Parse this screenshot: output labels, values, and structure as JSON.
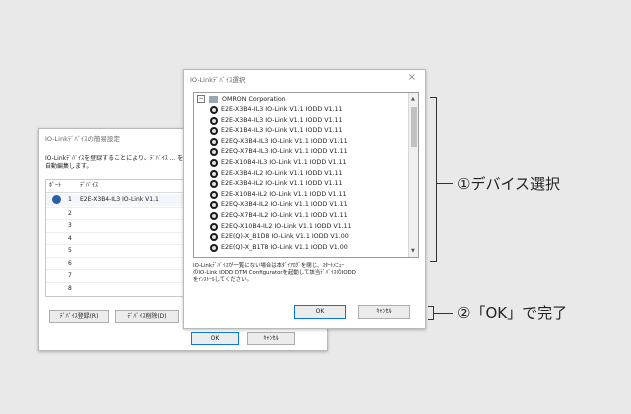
{
  "back_dialog": {
    "title": "IO-Linkﾃﾞﾊﾞｲｽの簡易設定",
    "description": "IO-Linkﾃﾞﾊﾞｲｽを登録することにより、ﾃﾞﾊﾞｲｽ ... を自動編集します。",
    "col_port": "ﾎﾟｰﾄ",
    "col_device": "ﾃﾞﾊﾞｲｽ",
    "ports": [
      "1",
      "2",
      "3",
      "4",
      "5",
      "6",
      "7",
      "8"
    ],
    "row1_device": "E2E-X3B4-IL3 IO-Link V1.1",
    "register_button": "ﾃﾞﾊﾞｲｽ登録(R)",
    "delete_button": "ﾃﾞﾊﾞｲｽ削除(D)",
    "ok_button": "OK",
    "cancel_button": "ｷｬﾝｾﾙ"
  },
  "front_dialog": {
    "title": "IO-Linkﾃﾞﾊﾞｲｽ選択",
    "close_glyph": "×",
    "root_node": "OMRON Corporation",
    "devices": [
      "E2E-X3B4-IL3 IO-Link V1.1 IODD V1.11",
      "E2E-X3B4-IL3 IO-Link V1.1 IODD V1.11",
      "E2E-X1B4-IL3 IO-Link V1.1 IODD V1.11",
      "E2EQ-X3B4-IL3 IO-Link V1.1 IODD V1.11",
      "E2EQ-X7B4-IL3 IO-Link V1.1 IODD V1.11",
      "E2E-X10B4-IL3 IO-Link V1.1 IODD V1.11",
      "E2E-X3B4-IL2 IO-Link V1.1 IODD V1.11",
      "E2E-X3B4-IL2 IO-Link V1.1 IODD V1.11",
      "E2E-X10B4-IL2 IO-Link V1.1 IODD V1.11",
      "E2EQ-X3B4-IL2 IO-Link V1.1 IODD V1.11",
      "E2EQ-X7B4-IL2 IO-Link V1.1 IODD V1.11",
      "E2EQ-X10B4-IL2 IO-Link V1.1 IODD V1.11",
      "E2E(Q)-X_B1D8 IO-Link V1.1 IODD V1.00",
      "E2E(Q)-X_B1T8 IO-Link V1.1 IODD V1.00"
    ],
    "note_line1": "IO-Linkﾃﾞﾊﾞｲｽが一覧にない場合は本ﾀﾞｲｱﾛｸﾞを閉じ、ｽﾀｰﾄﾒﾆｭｰ",
    "note_line2": "のIO-Link IODD DTM Configuratorを起動して該当ﾃﾞﾊﾞｲｽのIODD",
    "note_line3": "をｲﾝｽﾄｰﾙしてください。",
    "ok_button": "OK",
    "cancel_button": "ｷｬﾝｾﾙ"
  },
  "callouts": {
    "step1": "①デバイス選択",
    "step2": "②「OK」で完了"
  }
}
